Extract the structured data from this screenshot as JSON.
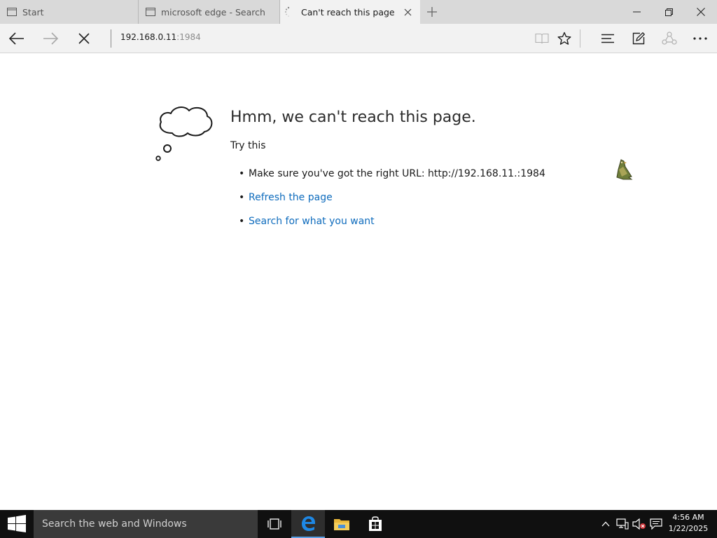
{
  "tabs": [
    {
      "label": "Start",
      "icon": "page-icon"
    },
    {
      "label": "microsoft edge - Search",
      "icon": "page-icon"
    },
    {
      "label": "Can't reach this page",
      "icon": "loading-spinner-icon",
      "active": true
    }
  ],
  "address": {
    "host": "192.168.0.11",
    "port": ":1984"
  },
  "error_page": {
    "title": "Hmm, we can't reach this page.",
    "try_this": "Try this",
    "suggestions": {
      "url_hint": "Make sure you've got the right URL: http://192.168.11.:1984",
      "refresh": "Refresh the page",
      "search": "Search for what you want"
    }
  },
  "taskbar": {
    "search_placeholder": "Search the web and Windows",
    "time": "4:56 AM",
    "date": "1/22/2025"
  },
  "colors": {
    "accent": "#0f6cbd",
    "tabbar": "#d9d9d9",
    "navbar": "#f2f2f2",
    "taskbar": "#101010",
    "edge_blue": "#1e88e5"
  }
}
